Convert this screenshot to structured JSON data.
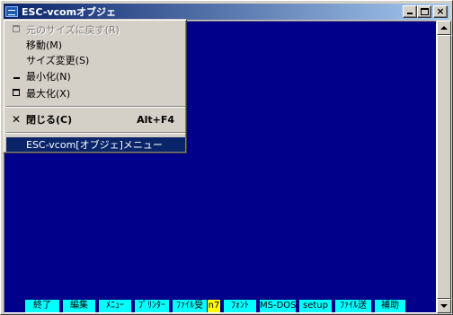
{
  "window": {
    "title": "ESC-vcomオブジェ",
    "buttons": {
      "minimize": "minimize-icon",
      "maximize": "maximize-icon",
      "close": "×"
    }
  },
  "system_menu": {
    "items": [
      {
        "label": "元のサイズに戻す(R)",
        "icon": "restore-icon",
        "disabled": true
      },
      {
        "label": "移動(M)",
        "icon": "",
        "disabled": false
      },
      {
        "label": "サイズ変更(S)",
        "icon": "",
        "disabled": false
      },
      {
        "label": "最小化(N)",
        "icon": "minimize-icon",
        "disabled": false
      },
      {
        "label": "最大化(X)",
        "icon": "maximize-icon",
        "disabled": false
      },
      {
        "label": "閉じる(C)",
        "accel": "Alt+F4",
        "icon": "close-icon",
        "bold": true
      },
      {
        "label": "ESC-vcom[オブジェ]メニュー",
        "icon": "",
        "selected": true
      }
    ]
  },
  "function_keys": [
    "終了",
    "編集",
    "ﾒﾆｭｰ",
    "ﾌﾟﾘﾝﾀｰ",
    "ﾌｧｲﾙ受",
    "n7",
    "ﾌｫﾝﾄ",
    "MS-DOS",
    "setup",
    "ﾌｧｲﾙ送",
    "補助"
  ],
  "colors": {
    "terminal_background": "#00008a",
    "function_key_background": "#00ffff",
    "function_key_active": "#ffff00",
    "menu_highlight": "#0a246a"
  }
}
